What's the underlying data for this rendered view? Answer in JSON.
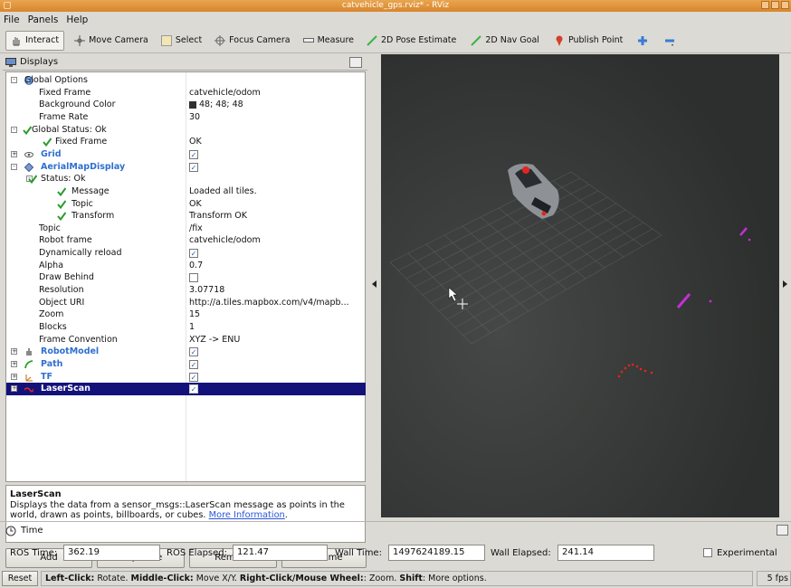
{
  "window": {
    "title": "catvehicle_gps.rviz* - RViz"
  },
  "menu": [
    "File",
    "Panels",
    "Help"
  ],
  "toolbar": {
    "tools": [
      {
        "label": "Interact",
        "icon": "hand-icon"
      },
      {
        "label": "Move Camera",
        "icon": "move-camera-icon"
      },
      {
        "label": "Select",
        "icon": "select-icon"
      },
      {
        "label": "Focus Camera",
        "icon": "focus-camera-icon"
      },
      {
        "label": "Measure",
        "icon": "measure-icon"
      },
      {
        "label": "2D Pose Estimate",
        "icon": "pose-estimate-arrow-icon"
      },
      {
        "label": "2D Nav Goal",
        "icon": "nav-goal-arrow-icon"
      },
      {
        "label": "Publish Point",
        "icon": "map-pin-icon"
      }
    ],
    "colors": {
      "pose": "#3bb34a",
      "pin": "#d2402a",
      "plus": "#3a7bd5"
    }
  },
  "displays": {
    "title": "Displays",
    "rows": [
      {
        "name": "Global Options",
        "value": ""
      },
      {
        "name": "Fixed Frame",
        "value": "catvehicle/odom"
      },
      {
        "name": "Background Color",
        "value": "48; 48; 48"
      },
      {
        "name": "Frame Rate",
        "value": "30"
      },
      {
        "name": "Global Status: Ok",
        "value": ""
      },
      {
        "name": "Fixed Frame",
        "value": "OK"
      },
      {
        "name": "Grid",
        "value": ""
      },
      {
        "name": "AerialMapDisplay",
        "value": ""
      },
      {
        "name": "Status: Ok",
        "value": ""
      },
      {
        "name": "Message",
        "value": "Loaded all tiles."
      },
      {
        "name": "Topic",
        "value": "OK"
      },
      {
        "name": "Transform",
        "value": "Transform OK"
      },
      {
        "name": "Topic",
        "value": "/fix"
      },
      {
        "name": "Robot frame",
        "value": "catvehicle/odom"
      },
      {
        "name": "Dynamically reload",
        "value": ""
      },
      {
        "name": "Alpha",
        "value": "0.7"
      },
      {
        "name": "Draw Behind",
        "value": ""
      },
      {
        "name": "Resolution",
        "value": "3.07718"
      },
      {
        "name": "Object URI",
        "value": "http://a.tiles.mapbox.com/v4/mapb..."
      },
      {
        "name": "Zoom",
        "value": "15"
      },
      {
        "name": "Blocks",
        "value": "1"
      },
      {
        "name": "Frame Convention",
        "value": "XYZ -> ENU"
      },
      {
        "name": "RobotModel",
        "value": ""
      },
      {
        "name": "Path",
        "value": ""
      },
      {
        "name": "TF",
        "value": ""
      },
      {
        "name": "LaserScan",
        "value": ""
      }
    ],
    "checked": {
      "grid": true,
      "aerial": true,
      "dyn_reload": true,
      "draw_behind": false,
      "robot_model": true,
      "path": true,
      "tf": true,
      "laserscan": true
    },
    "bg_swatch": "#303030"
  },
  "description": {
    "title": "LaserScan",
    "text": "Displays the data from a sensor_msgs::LaserScan message as points in the world, drawn as points, billboards, or cubes.",
    "link": "More Information",
    "period": "."
  },
  "buttons": {
    "add": "Add",
    "duplicate": "Duplicate",
    "remove": "Remove",
    "rename": "Rename"
  },
  "time": {
    "title": "Time",
    "ros_time_label": "ROS Time:",
    "ros_time": "362.19",
    "ros_elapsed_label": "ROS Elapsed:",
    "ros_elapsed": "121.47",
    "wall_time_label": "Wall Time:",
    "wall_time": "1497624189.15",
    "wall_elapsed_label": "Wall Elapsed:",
    "wall_elapsed": "241.14",
    "experimental": "Experimental"
  },
  "status": {
    "reset": "Reset",
    "b1": "Left-Click:",
    "t1": " Rotate. ",
    "b2": "Middle-Click:",
    "t2": " Move X/Y. ",
    "b3": "Right-Click/Mouse Wheel:",
    "t3": ": Zoom. ",
    "b4": "Shift",
    "t4": ": More options.",
    "fps": "5 fps"
  },
  "scene": {
    "laser_color": "#e0261f",
    "path_color": "#c52fd6",
    "grid_color": "#6a6e6c"
  }
}
